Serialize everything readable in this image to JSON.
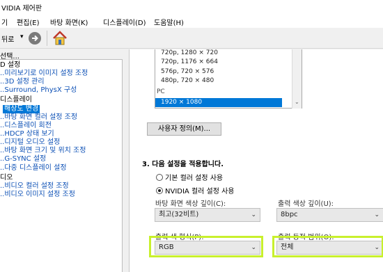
{
  "window": {
    "title": "VIDIA 제어판"
  },
  "menu": [
    "기",
    "편집(E)",
    "바탕 화면(K)",
    "디스플레이(D)",
    "도움말(H)"
  ],
  "toolbar": {
    "back_label": "뒤로",
    "dropdown": "▾"
  },
  "task_label": "선택...",
  "tree": {
    "items": [
      {
        "label": "D 설정",
        "kind": "cat"
      },
      {
        "label": "..미리보기로 이미지 설정 조정",
        "kind": "leaf"
      },
      {
        "label": "..3D 설정 관리",
        "kind": "leaf"
      },
      {
        "label": "..Surround, PhysX 구성",
        "kind": "leaf"
      },
      {
        "label": "디스플레이",
        "kind": "cat"
      },
      {
        "label": "해상도 변경",
        "kind": "sel"
      },
      {
        "label": "..바탕 화면 컬러 설정 조정",
        "kind": "leaf"
      },
      {
        "label": "..디스플레이 회전",
        "kind": "leaf"
      },
      {
        "label": "..HDCP 상태 보기",
        "kind": "leaf"
      },
      {
        "label": "..디지털 오디오 설정",
        "kind": "leaf"
      },
      {
        "label": "..바탕 화면 크기 및 위치 조정",
        "kind": "leaf"
      },
      {
        "label": "..G-SYNC 설정",
        "kind": "leaf"
      },
      {
        "label": "..다중 디스플레이 설정",
        "kind": "leaf"
      },
      {
        "label": "디오",
        "kind": "cat"
      },
      {
        "label": "..비디오 컬러 설정 조정",
        "kind": "leaf"
      },
      {
        "label": "..비디오 이미지 설정 조정",
        "kind": "leaf"
      }
    ]
  },
  "resolution_list": {
    "rows": [
      "720p, 1280 × 720",
      "720p, 1176 × 664",
      "576p, 720 × 576",
      "480p, 720 × 480"
    ],
    "group": "PC",
    "selected": "1920 × 1080"
  },
  "customize_button": "사용자 정의(M)...",
  "section3": {
    "title": "3. 다음 설정을 적용합니다.",
    "radio_default": "기본 컬러 설정 사용",
    "radio_nvidia": "NVIDIA 컬러 설정 사용",
    "desktop_depth_label": "바탕 화면 색상 깊이(C):",
    "desktop_depth_value": "최고(32비트)",
    "output_depth_label": "출력 색상 깊이(U):",
    "output_depth_value": "8bpc",
    "output_format_label": "출력 색 형식(P):",
    "output_format_value": "RGB",
    "output_range_label": "출력 동적 범위(O):",
    "output_range_value": "전체"
  },
  "colors": {
    "highlight": "#c8f02d",
    "selection": "#0078d7",
    "link": "#0b4fb5"
  }
}
